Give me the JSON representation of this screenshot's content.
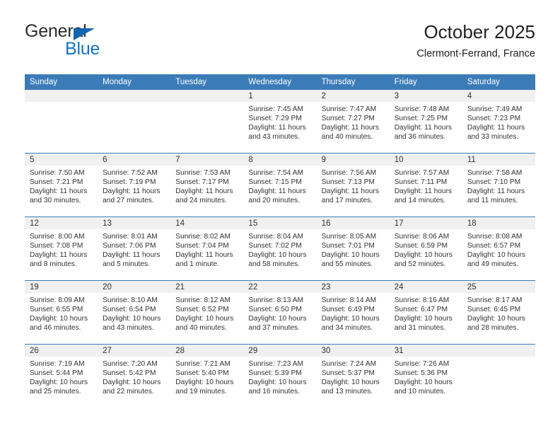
{
  "brand": {
    "name_top": "General",
    "name_bottom": "Blue",
    "triangle_color": "#1267b2",
    "blue_text_color": "#1572c6"
  },
  "header": {
    "title": "October 2025",
    "subtitle": "Clermont-Ferrand, France"
  },
  "theme": {
    "header_blue": "#3b7cb8",
    "daynum_band": "#f0f0f0",
    "text": "#333333"
  },
  "weekday_headers": [
    "Sunday",
    "Monday",
    "Tuesday",
    "Wednesday",
    "Thursday",
    "Friday",
    "Saturday"
  ],
  "weeks": [
    [
      {
        "day": "",
        "empty": true,
        "sunrise": "",
        "sunset": "",
        "daylight": ""
      },
      {
        "day": "",
        "empty": true,
        "sunrise": "",
        "sunset": "",
        "daylight": ""
      },
      {
        "day": "",
        "empty": true,
        "sunrise": "",
        "sunset": "",
        "daylight": ""
      },
      {
        "day": "1",
        "empty": false,
        "sunrise": "Sunrise: 7:45 AM",
        "sunset": "Sunset: 7:29 PM",
        "daylight": "Daylight: 11 hours and 43 minutes."
      },
      {
        "day": "2",
        "empty": false,
        "sunrise": "Sunrise: 7:47 AM",
        "sunset": "Sunset: 7:27 PM",
        "daylight": "Daylight: 11 hours and 40 minutes."
      },
      {
        "day": "3",
        "empty": false,
        "sunrise": "Sunrise: 7:48 AM",
        "sunset": "Sunset: 7:25 PM",
        "daylight": "Daylight: 11 hours and 36 minutes."
      },
      {
        "day": "4",
        "empty": false,
        "sunrise": "Sunrise: 7:49 AM",
        "sunset": "Sunset: 7:23 PM",
        "daylight": "Daylight: 11 hours and 33 minutes."
      }
    ],
    [
      {
        "day": "5",
        "empty": false,
        "sunrise": "Sunrise: 7:50 AM",
        "sunset": "Sunset: 7:21 PM",
        "daylight": "Daylight: 11 hours and 30 minutes."
      },
      {
        "day": "6",
        "empty": false,
        "sunrise": "Sunrise: 7:52 AM",
        "sunset": "Sunset: 7:19 PM",
        "daylight": "Daylight: 11 hours and 27 minutes."
      },
      {
        "day": "7",
        "empty": false,
        "sunrise": "Sunrise: 7:53 AM",
        "sunset": "Sunset: 7:17 PM",
        "daylight": "Daylight: 11 hours and 24 minutes."
      },
      {
        "day": "8",
        "empty": false,
        "sunrise": "Sunrise: 7:54 AM",
        "sunset": "Sunset: 7:15 PM",
        "daylight": "Daylight: 11 hours and 20 minutes."
      },
      {
        "day": "9",
        "empty": false,
        "sunrise": "Sunrise: 7:56 AM",
        "sunset": "Sunset: 7:13 PM",
        "daylight": "Daylight: 11 hours and 17 minutes."
      },
      {
        "day": "10",
        "empty": false,
        "sunrise": "Sunrise: 7:57 AM",
        "sunset": "Sunset: 7:11 PM",
        "daylight": "Daylight: 11 hours and 14 minutes."
      },
      {
        "day": "11",
        "empty": false,
        "sunrise": "Sunrise: 7:58 AM",
        "sunset": "Sunset: 7:10 PM",
        "daylight": "Daylight: 11 hours and 11 minutes."
      }
    ],
    [
      {
        "day": "12",
        "empty": false,
        "sunrise": "Sunrise: 8:00 AM",
        "sunset": "Sunset: 7:08 PM",
        "daylight": "Daylight: 11 hours and 8 minutes."
      },
      {
        "day": "13",
        "empty": false,
        "sunrise": "Sunrise: 8:01 AM",
        "sunset": "Sunset: 7:06 PM",
        "daylight": "Daylight: 11 hours and 5 minutes."
      },
      {
        "day": "14",
        "empty": false,
        "sunrise": "Sunrise: 8:02 AM",
        "sunset": "Sunset: 7:04 PM",
        "daylight": "Daylight: 11 hours and 1 minute."
      },
      {
        "day": "15",
        "empty": false,
        "sunrise": "Sunrise: 8:04 AM",
        "sunset": "Sunset: 7:02 PM",
        "daylight": "Daylight: 10 hours and 58 minutes."
      },
      {
        "day": "16",
        "empty": false,
        "sunrise": "Sunrise: 8:05 AM",
        "sunset": "Sunset: 7:01 PM",
        "daylight": "Daylight: 10 hours and 55 minutes."
      },
      {
        "day": "17",
        "empty": false,
        "sunrise": "Sunrise: 8:06 AM",
        "sunset": "Sunset: 6:59 PM",
        "daylight": "Daylight: 10 hours and 52 minutes."
      },
      {
        "day": "18",
        "empty": false,
        "sunrise": "Sunrise: 8:08 AM",
        "sunset": "Sunset: 6:57 PM",
        "daylight": "Daylight: 10 hours and 49 minutes."
      }
    ],
    [
      {
        "day": "19",
        "empty": false,
        "sunrise": "Sunrise: 8:09 AM",
        "sunset": "Sunset: 6:55 PM",
        "daylight": "Daylight: 10 hours and 46 minutes."
      },
      {
        "day": "20",
        "empty": false,
        "sunrise": "Sunrise: 8:10 AM",
        "sunset": "Sunset: 6:54 PM",
        "daylight": "Daylight: 10 hours and 43 minutes."
      },
      {
        "day": "21",
        "empty": false,
        "sunrise": "Sunrise: 8:12 AM",
        "sunset": "Sunset: 6:52 PM",
        "daylight": "Daylight: 10 hours and 40 minutes."
      },
      {
        "day": "22",
        "empty": false,
        "sunrise": "Sunrise: 8:13 AM",
        "sunset": "Sunset: 6:50 PM",
        "daylight": "Daylight: 10 hours and 37 minutes."
      },
      {
        "day": "23",
        "empty": false,
        "sunrise": "Sunrise: 8:14 AM",
        "sunset": "Sunset: 6:49 PM",
        "daylight": "Daylight: 10 hours and 34 minutes."
      },
      {
        "day": "24",
        "empty": false,
        "sunrise": "Sunrise: 8:16 AM",
        "sunset": "Sunset: 6:47 PM",
        "daylight": "Daylight: 10 hours and 31 minutes."
      },
      {
        "day": "25",
        "empty": false,
        "sunrise": "Sunrise: 8:17 AM",
        "sunset": "Sunset: 6:45 PM",
        "daylight": "Daylight: 10 hours and 28 minutes."
      }
    ],
    [
      {
        "day": "26",
        "empty": false,
        "sunrise": "Sunrise: 7:19 AM",
        "sunset": "Sunset: 5:44 PM",
        "daylight": "Daylight: 10 hours and 25 minutes."
      },
      {
        "day": "27",
        "empty": false,
        "sunrise": "Sunrise: 7:20 AM",
        "sunset": "Sunset: 5:42 PM",
        "daylight": "Daylight: 10 hours and 22 minutes."
      },
      {
        "day": "28",
        "empty": false,
        "sunrise": "Sunrise: 7:21 AM",
        "sunset": "Sunset: 5:40 PM",
        "daylight": "Daylight: 10 hours and 19 minutes."
      },
      {
        "day": "29",
        "empty": false,
        "sunrise": "Sunrise: 7:23 AM",
        "sunset": "Sunset: 5:39 PM",
        "daylight": "Daylight: 10 hours and 16 minutes."
      },
      {
        "day": "30",
        "empty": false,
        "sunrise": "Sunrise: 7:24 AM",
        "sunset": "Sunset: 5:37 PM",
        "daylight": "Daylight: 10 hours and 13 minutes."
      },
      {
        "day": "31",
        "empty": false,
        "sunrise": "Sunrise: 7:26 AM",
        "sunset": "Sunset: 5:36 PM",
        "daylight": "Daylight: 10 hours and 10 minutes."
      },
      {
        "day": "",
        "empty": true,
        "sunrise": "",
        "sunset": "",
        "daylight": ""
      }
    ]
  ]
}
